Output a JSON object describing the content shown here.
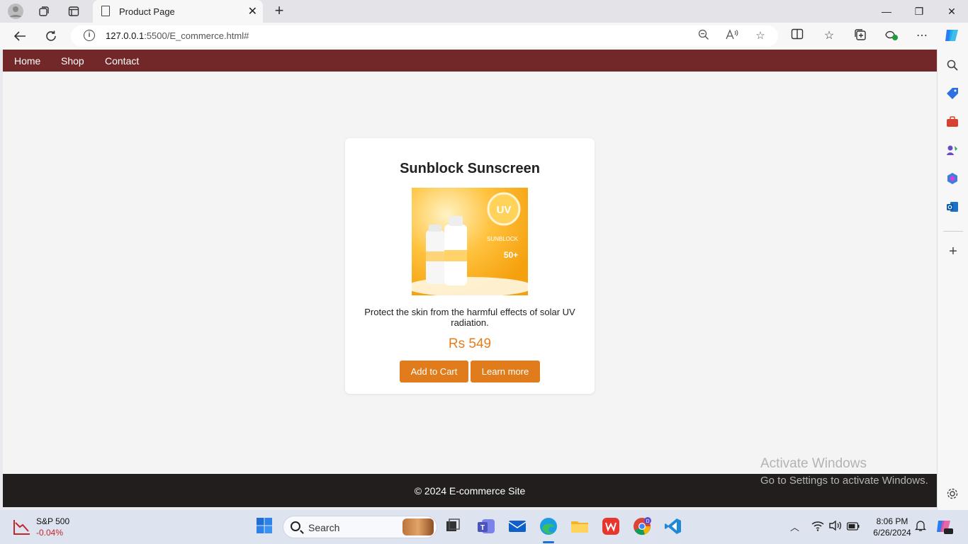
{
  "browser": {
    "tab_title": "Product Page",
    "url_host": "127.0.0.1",
    "url_rest": ":5500/E_commerce.html#"
  },
  "site": {
    "nav": [
      "Home",
      "Shop",
      "Contact"
    ],
    "product": {
      "name": "Sunblock Sunscreen",
      "description": "Protect the skin from the harmful effects of solar UV radiation.",
      "price": "Rs 549",
      "add_to_cart_label": "Add to Cart",
      "learn_more_label": "Learn more",
      "image_text": {
        "badge": "UV",
        "brand": "SUNBLOCK",
        "spf": "50+"
      }
    },
    "footer": "© 2024 E-commerce Site"
  },
  "watermark": {
    "line1": "Activate Windows",
    "line2": "Go to Settings to activate Windows."
  },
  "taskbar": {
    "search_placeholder": "Search",
    "stock_name": "S&P 500",
    "stock_change": "-0.04%",
    "time": "8:06 PM",
    "date": "6/26/2024"
  },
  "colors": {
    "nav_bg": "#722728",
    "accent": "#e07c1b",
    "footer_bg": "#221e1e"
  }
}
